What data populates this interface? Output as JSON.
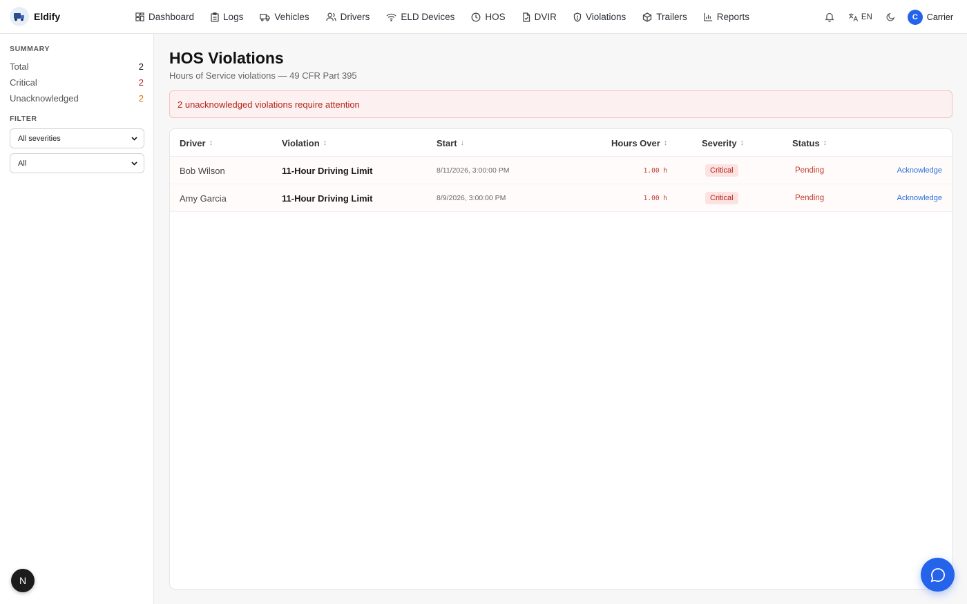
{
  "brand": {
    "name": "Eldify"
  },
  "nav": [
    {
      "label": "Dashboard",
      "icon": "dashboard-icon"
    },
    {
      "label": "Logs",
      "icon": "logs-icon"
    },
    {
      "label": "Vehicles",
      "icon": "truck-icon"
    },
    {
      "label": "Drivers",
      "icon": "users-icon"
    },
    {
      "label": "ELD Devices",
      "icon": "wifi-icon"
    },
    {
      "label": "HOS",
      "icon": "clock-icon"
    },
    {
      "label": "DVIR",
      "icon": "file-check-icon"
    },
    {
      "label": "Violations",
      "icon": "shield-icon"
    },
    {
      "label": "Trailers",
      "icon": "box-icon"
    },
    {
      "label": "Reports",
      "icon": "chart-icon"
    }
  ],
  "header_tools": {
    "language": "EN",
    "user_initial": "C",
    "user_name": "Carrier"
  },
  "summary": {
    "title": "SUMMARY",
    "total_label": "Total",
    "total_value": "2",
    "critical_label": "Critical",
    "critical_value": "2",
    "unack_label": "Unacknowledged",
    "unack_value": "2"
  },
  "filter": {
    "title": "FILTER",
    "severity_selected": "All severities",
    "status_selected": "All"
  },
  "page": {
    "title": "HOS Violations",
    "subtitle": "Hours of Service violations — 49 CFR Part 395",
    "alert": "2 unacknowledged violations require attention"
  },
  "table": {
    "columns": {
      "driver": "Driver",
      "violation": "Violation",
      "start": "Start",
      "hours": "Hours Over",
      "severity": "Severity",
      "status": "Status"
    },
    "rows": [
      {
        "driver": "Bob Wilson",
        "violation": "11-Hour Driving Limit",
        "start": "8/11/2026, 3:00:00 PM",
        "hours": "1.00 h",
        "severity": "Critical",
        "status": "Pending",
        "action": "Acknowledge"
      },
      {
        "driver": "Amy Garcia",
        "violation": "11-Hour Driving Limit",
        "start": "8/9/2026, 3:00:00 PM",
        "hours": "1.00 h",
        "severity": "Critical",
        "status": "Pending",
        "action": "Acknowledge"
      }
    ]
  },
  "misc": {
    "n_badge": "N"
  },
  "colors": {
    "accent": "#2563eb",
    "critical": "#b42318",
    "warning": "#d97706"
  }
}
